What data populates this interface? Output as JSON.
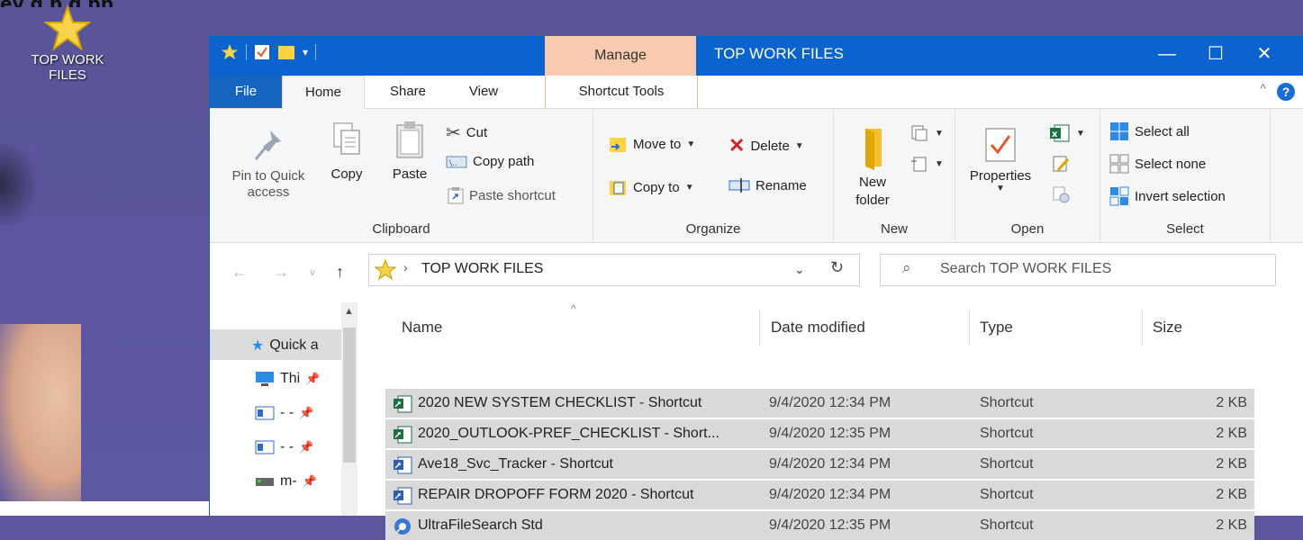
{
  "desktop": {
    "banner_text": "ey g     p g                              pp",
    "icon_label": "TOP WORK FILES"
  },
  "window": {
    "title": "TOP WORK FILES",
    "manage_tab": "Manage",
    "controls": {
      "minimize": "—",
      "maximize": "☐",
      "close": "✕"
    }
  },
  "tabs": {
    "file": "File",
    "home": "Home",
    "share": "Share",
    "view": "View",
    "shortcut_tools": "Shortcut Tools",
    "help": "?"
  },
  "ribbon": {
    "clipboard": {
      "label": "Clipboard",
      "pin": "Pin to Quick access",
      "copy": "Copy",
      "paste": "Paste",
      "cut": "Cut",
      "copy_path": "Copy path",
      "paste_shortcut": "Paste shortcut"
    },
    "organize": {
      "label": "Organize",
      "move_to": "Move to",
      "copy_to": "Copy to",
      "delete": "Delete",
      "rename": "Rename"
    },
    "new": {
      "label": "New",
      "new_folder": "New folder"
    },
    "open": {
      "label": "Open",
      "properties": "Properties"
    },
    "select": {
      "label": "Select",
      "select_all": "Select all",
      "select_none": "Select none",
      "invert": "Invert selection"
    }
  },
  "address": {
    "path": "TOP WORK FILES",
    "search_placeholder": "Search TOP WORK FILES"
  },
  "nav_pane": {
    "items": [
      {
        "label": "Quick a",
        "icon": "star-icon"
      },
      {
        "label": "Thi",
        "icon": "pc-icon"
      },
      {
        "label": "- -",
        "icon": "doc-icon"
      },
      {
        "label": "- -",
        "icon": "doc-icon"
      },
      {
        "label": "m-",
        "icon": "drive-icon"
      }
    ]
  },
  "columns": {
    "name": "Name",
    "date": "Date modified",
    "type": "Type",
    "size": "Size"
  },
  "files": [
    {
      "name": "2020 NEW SYSTEM CHECKLIST - Shortcut",
      "date": "9/4/2020 12:34 PM",
      "type": "Shortcut",
      "size": "2 KB",
      "icon": "sheet-shortcut-icon"
    },
    {
      "name": "2020_OUTLOOK-PREF_CHECKLIST - Short...",
      "date": "9/4/2020 12:35 PM",
      "type": "Shortcut",
      "size": "2 KB",
      "icon": "sheet-shortcut-icon"
    },
    {
      "name": "Ave18_Svc_Tracker - Shortcut",
      "date": "9/4/2020 12:34 PM",
      "type": "Shortcut",
      "size": "2 KB",
      "icon": "db-shortcut-icon"
    },
    {
      "name": "REPAIR DROPOFF FORM 2020 - Shortcut",
      "date": "9/4/2020 12:34 PM",
      "type": "Shortcut",
      "size": "2 KB",
      "icon": "db-shortcut-icon"
    },
    {
      "name": "UltraFileSearch Std",
      "date": "9/4/2020 12:35 PM",
      "type": "Shortcut",
      "size": "2 KB",
      "icon": "app-shortcut-icon"
    }
  ]
}
